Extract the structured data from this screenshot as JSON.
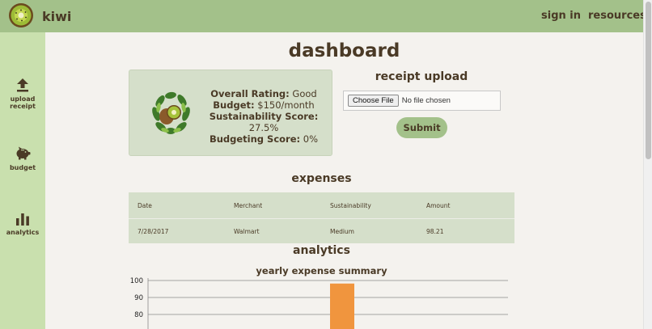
{
  "header": {
    "brand": "kiwi",
    "nav": [
      {
        "label": "sign in"
      },
      {
        "label": "resources"
      }
    ]
  },
  "sidebar": {
    "items": [
      {
        "label_line1": "upload",
        "label_line2": "receipt",
        "icon": "upload-icon"
      },
      {
        "label_line1": "budget",
        "label_line2": "",
        "icon": "piggy-bank-icon"
      },
      {
        "label_line1": "analytics",
        "label_line2": "",
        "icon": "bar-chart-icon"
      }
    ]
  },
  "page": {
    "title": "dashboard"
  },
  "rating": {
    "overall_label": "Overall Rating:",
    "overall_value": "Good",
    "budget_label": "Budget:",
    "budget_value": "$150/month",
    "sustainability_label": "Sustainability Score:",
    "sustainability_value": "27.5%",
    "budgeting_label": "Budgeting Score:",
    "budgeting_value": "0%"
  },
  "upload": {
    "title": "receipt upload",
    "choose_label": "Choose File",
    "file_status": "No file chosen",
    "submit_label": "Submit"
  },
  "expenses": {
    "title": "expenses",
    "columns": [
      "Date",
      "Merchant",
      "Sustainability",
      "Amount"
    ],
    "rows": [
      [
        "7/28/2017",
        "Walmart",
        "Medium",
        "98.21"
      ]
    ]
  },
  "analytics": {
    "title": "analytics"
  },
  "chart_data": {
    "type": "bar",
    "title": "yearly expense summary",
    "yticks": [
      100,
      90,
      80
    ],
    "ylim": [
      0,
      100
    ],
    "values": [
      98.21
    ],
    "bar_color": "#f0953e",
    "grid": true
  },
  "colors": {
    "header": "#a3c18a",
    "sidebar": "#c9e0ae",
    "card": "#d5dfca",
    "text": "#4a3a26",
    "bar": "#f0953e"
  }
}
